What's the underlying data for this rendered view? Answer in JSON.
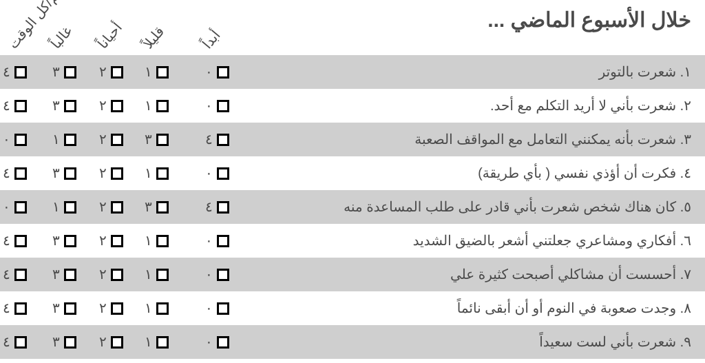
{
  "heading": "خلال الأسبوع الماضي ...",
  "scale_labels": [
    "معظم/كل الوقت",
    "غالباً",
    "أحياناً",
    "قليلاً",
    "أبداً"
  ],
  "questions": [
    {
      "text": "١. شعرت بالتوتر",
      "scores": [
        "٤",
        "٣",
        "٢",
        "١",
        "٠"
      ],
      "shaded": true
    },
    {
      "text": "٢. شعرت بأني لا أريد التكلم مع أحد.",
      "scores": [
        "٤",
        "٣",
        "٢",
        "١",
        "٠"
      ],
      "shaded": false
    },
    {
      "text": "٣. شعرت بأنه يمكنني التعامل مع المواقف الصعبة",
      "scores": [
        "٠",
        "١",
        "٢",
        "٣",
        "٤"
      ],
      "shaded": true
    },
    {
      "text": "٤. فكرت أن أؤذي نفسي ( بأي طريقة)",
      "scores": [
        "٤",
        "٣",
        "٢",
        "١",
        "٠"
      ],
      "shaded": false
    },
    {
      "text": "٥. كان هناك شخص شعرت بأني قادر على طلب المساعدة منه",
      "scores": [
        "٠",
        "١",
        "٢",
        "٣",
        "٤"
      ],
      "shaded": true
    },
    {
      "text": "٦. أفكاري ومشاعري جعلتني أشعر بالضيق الشديد",
      "scores": [
        "٤",
        "٣",
        "٢",
        "١",
        "٠"
      ],
      "shaded": false
    },
    {
      "text": "٧. أحسست أن مشاكلي أصبحت كثيرة علي",
      "scores": [
        "٤",
        "٣",
        "٢",
        "١",
        "٠"
      ],
      "shaded": true
    },
    {
      "text": "٨. وجدت صعوبة في النوم أو أن أبقى نائماً",
      "scores": [
        "٤",
        "٣",
        "٢",
        "١",
        "٠"
      ],
      "shaded": false
    },
    {
      "text": "٩. شعرت بأني لست سعيداً",
      "scores": [
        "٤",
        "٣",
        "٢",
        "١",
        "٠"
      ],
      "shaded": true
    }
  ]
}
